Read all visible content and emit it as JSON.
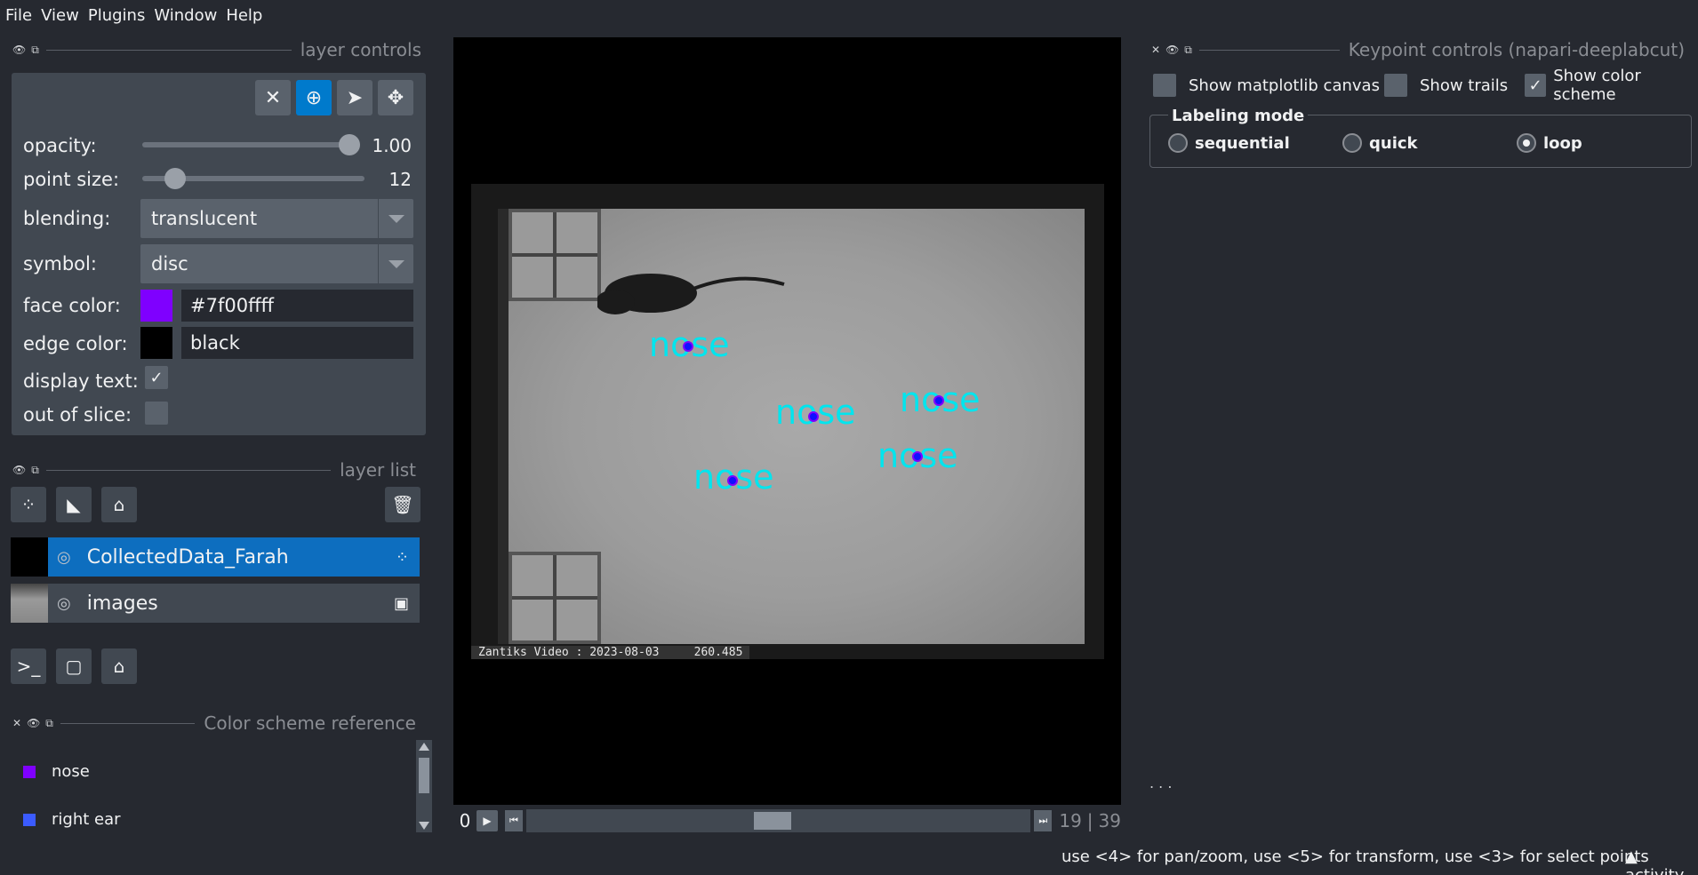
{
  "menu": [
    "File",
    "View",
    "Plugins",
    "Window",
    "Help"
  ],
  "layer_controls": {
    "title": "layer controls",
    "opacity_label": "opacity:",
    "opacity_value": "1.00",
    "point_size_label": "point size:",
    "point_size_value": "12",
    "blending_label": "blending:",
    "blending_value": "translucent",
    "symbol_label": "symbol:",
    "symbol_value": "disc",
    "face_color_label": "face color:",
    "face_color_value": "#7f00ffff",
    "face_color_swatch": "#7f00ff",
    "edge_color_label": "edge color:",
    "edge_color_value": "black",
    "edge_color_swatch": "#000000",
    "display_text_label": "display text:",
    "display_text_checked": true,
    "out_of_slice_label": "out of slice:",
    "out_of_slice_checked": false
  },
  "layer_list": {
    "title": "layer list",
    "layers": [
      {
        "name": "CollectedData_Farah",
        "selected": true,
        "type_icon": "points-icon"
      },
      {
        "name": "images",
        "selected": false,
        "type_icon": "image-icon"
      }
    ]
  },
  "viewer": {
    "caption": "Zantiks Video : 2023-08-03     260.485",
    "keypoint_label": "nose",
    "keypoint_count": 5
  },
  "dims": {
    "start": "0",
    "current": "19",
    "total": "39"
  },
  "keypoint_controls": {
    "title": "Keypoint controls (napari-deeplabcut)",
    "show_matplotlib": "Show matplotlib canvas",
    "show_trails": "Show trails",
    "show_color_scheme": "Show color scheme",
    "labeling_mode_title": "Labeling mode",
    "modes": [
      "sequential",
      "quick",
      "loop"
    ],
    "selected_mode": "loop",
    "ellipsis": ". . ."
  },
  "color_scheme_reference": {
    "title": "Color scheme reference",
    "items": [
      {
        "label": "nose",
        "color": "#7f00ff"
      },
      {
        "label": "right ear",
        "color": "#3b5bff"
      }
    ]
  },
  "status_bar": {
    "message": "use <4> for pan/zoom, use <5> for transform, use <3> for select points",
    "activity": "activity"
  }
}
